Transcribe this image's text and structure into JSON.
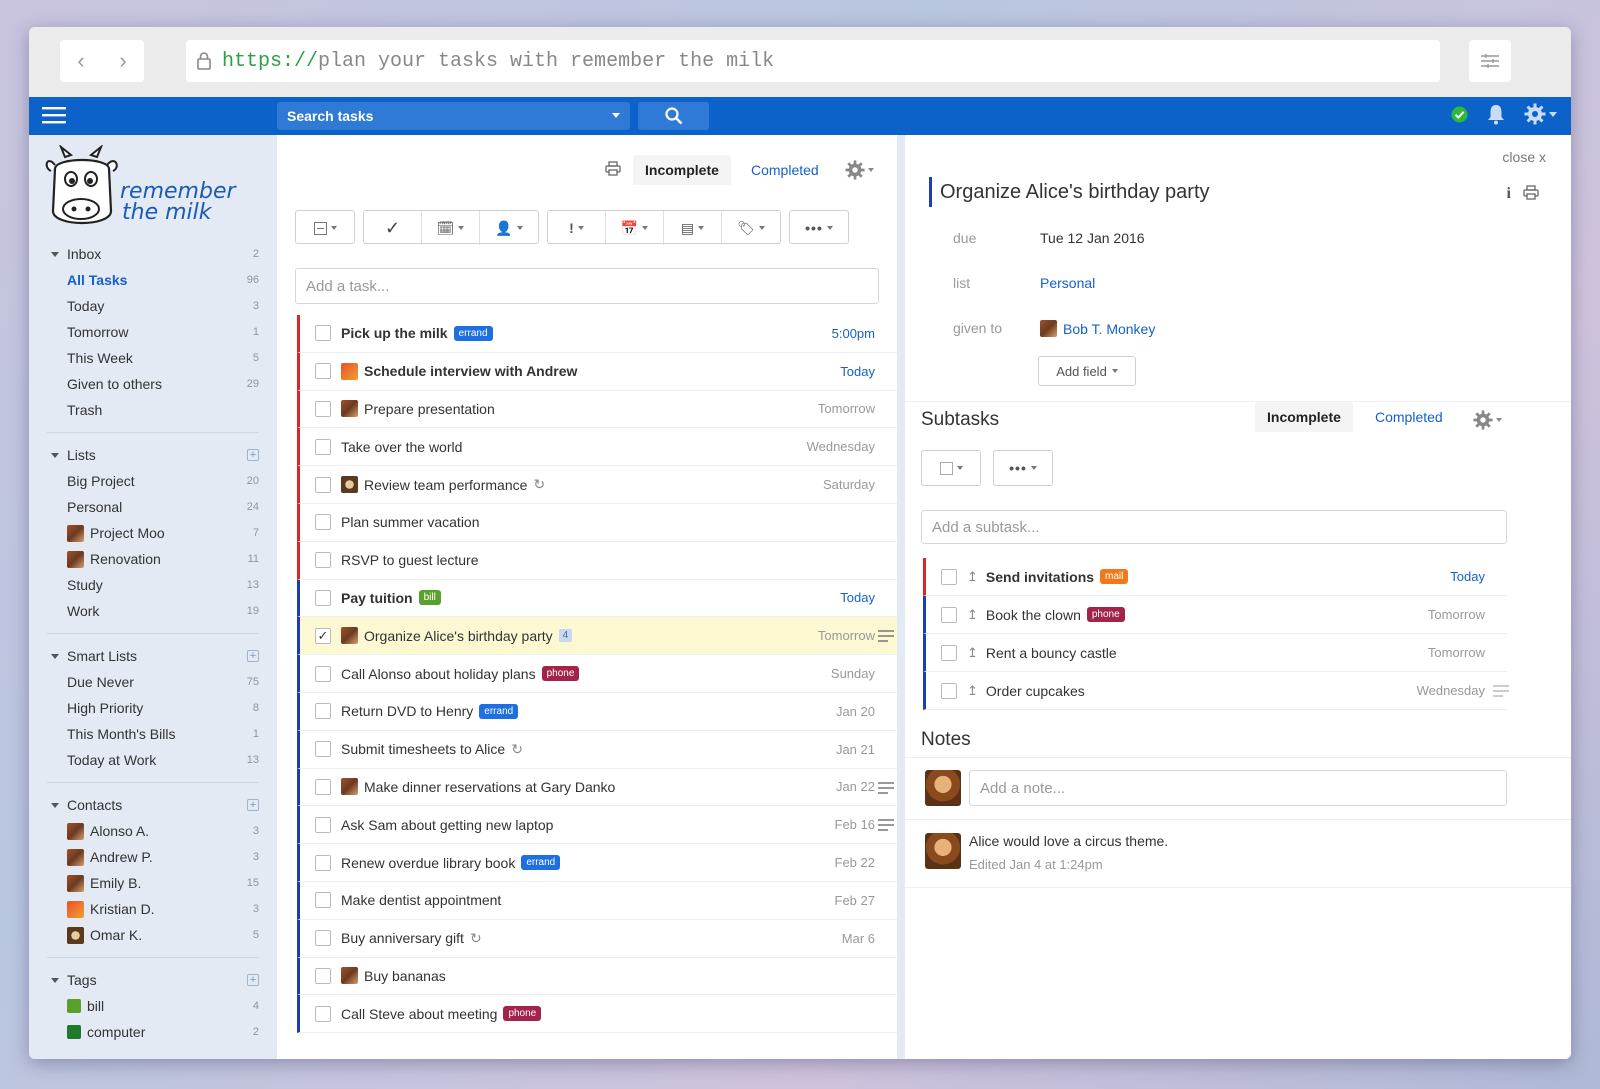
{
  "browser": {
    "url_scheme": "https://",
    "url_rest": "plan your tasks with remember the milk"
  },
  "topbar": {
    "search_placeholder": "Search tasks"
  },
  "logo": {
    "line1": "remember",
    "line2": "the milk"
  },
  "sidebar": {
    "inbox": {
      "label": "Inbox",
      "count": "2",
      "items": [
        {
          "label": "All Tasks",
          "count": "96"
        },
        {
          "label": "Today",
          "count": "3"
        },
        {
          "label": "Tomorrow",
          "count": "1"
        },
        {
          "label": "This Week",
          "count": "5"
        },
        {
          "label": "Given to others",
          "count": "29"
        },
        {
          "label": "Trash",
          "count": ""
        }
      ]
    },
    "lists": {
      "label": "Lists",
      "items": [
        {
          "label": "Big Project",
          "count": "20"
        },
        {
          "label": "Personal",
          "count": "24"
        },
        {
          "label": "Project Moo",
          "count": "7"
        },
        {
          "label": "Renovation",
          "count": "11"
        },
        {
          "label": "Study",
          "count": "13"
        },
        {
          "label": "Work",
          "count": "19"
        }
      ]
    },
    "smart_lists": {
      "label": "Smart Lists",
      "items": [
        {
          "label": "Due Never",
          "count": "75"
        },
        {
          "label": "High Priority",
          "count": "8"
        },
        {
          "label": "This Month's Bills",
          "count": "1"
        },
        {
          "label": "Today at Work",
          "count": "13"
        }
      ]
    },
    "contacts": {
      "label": "Contacts",
      "items": [
        {
          "label": "Alonso A.",
          "count": "3"
        },
        {
          "label": "Andrew P.",
          "count": "3"
        },
        {
          "label": "Emily B.",
          "count": "15"
        },
        {
          "label": "Kristian D.",
          "count": "3"
        },
        {
          "label": "Omar K.",
          "count": "5"
        }
      ]
    },
    "tags": {
      "label": "Tags",
      "items": [
        {
          "label": "bill",
          "count": "4",
          "color": "#5aa02c"
        },
        {
          "label": "computer",
          "count": "2",
          "color": "#1e7a2a"
        }
      ]
    }
  },
  "tasks_panel": {
    "tab_incomplete": "Incomplete",
    "tab_completed": "Completed",
    "add_placeholder": "Add a task...",
    "tasks": [
      {
        "name": "Pick up the milk",
        "tag": "errand",
        "due": "5:00pm"
      },
      {
        "name": "Schedule interview with Andrew",
        "due": "Today"
      },
      {
        "name": "Prepare presentation",
        "due": "Tomorrow"
      },
      {
        "name": "Take over the world",
        "due": "Wednesday"
      },
      {
        "name": "Review team performance",
        "due": "Saturday"
      },
      {
        "name": "Plan summer vacation",
        "due": ""
      },
      {
        "name": "RSVP to guest lecture",
        "due": ""
      },
      {
        "name": "Pay tuition",
        "tag": "bill",
        "due": "Today"
      },
      {
        "name": "Organize Alice's birthday party",
        "badge": "4",
        "due": "Tomorrow"
      },
      {
        "name": "Call Alonso about holiday plans",
        "tag": "phone",
        "due": "Sunday"
      },
      {
        "name": "Return DVD to Henry",
        "tag": "errand",
        "due": "Jan 20"
      },
      {
        "name": "Submit timesheets to Alice",
        "due": "Jan 21"
      },
      {
        "name": "Make dinner reservations at Gary Danko",
        "due": "Jan 22"
      },
      {
        "name": "Ask Sam about getting new laptop",
        "due": "Feb 16"
      },
      {
        "name": "Renew overdue library book",
        "tag": "errand",
        "due": "Feb 22"
      },
      {
        "name": "Make dentist appointment",
        "due": "Feb 27"
      },
      {
        "name": "Buy anniversary gift",
        "due": "Mar 6"
      },
      {
        "name": "Buy bananas",
        "due": ""
      },
      {
        "name": "Call Steve about meeting",
        "tag": "phone",
        "due": ""
      }
    ]
  },
  "detail": {
    "close": "close x",
    "title": "Organize Alice's birthday party",
    "due_label": "due",
    "due_value": "Tue 12 Jan 2016",
    "list_label": "list",
    "list_value": "Personal",
    "given_label": "given to",
    "given_value": "Bob T. Monkey",
    "add_field": "Add field",
    "subtasks_title": "Subtasks",
    "sub_tab_incomplete": "Incomplete",
    "sub_tab_completed": "Completed",
    "add_subtask_placeholder": "Add a subtask...",
    "subtasks": [
      {
        "name": "Send invitations",
        "tag": "mail",
        "due": "Today"
      },
      {
        "name": "Book the clown",
        "tag": "phone",
        "due": "Tomorrow"
      },
      {
        "name": "Rent a bouncy castle",
        "due": "Tomorrow"
      },
      {
        "name": "Order cupcakes",
        "due": "Wednesday"
      }
    ],
    "notes_title": "Notes",
    "add_note_placeholder": "Add a note...",
    "note_text": "Alice would love a circus theme.",
    "note_meta": "Edited Jan 4 at 1:24pm"
  },
  "colors": {
    "brand_blue": "#0c62c9",
    "priority1": "#d9262b",
    "priority_none": "#1b3fb0",
    "tag_errand": "#1e6fe0",
    "tag_bill": "#5aa02c",
    "tag_phone": "#a3244a",
    "tag_mail": "#f07a1a"
  }
}
